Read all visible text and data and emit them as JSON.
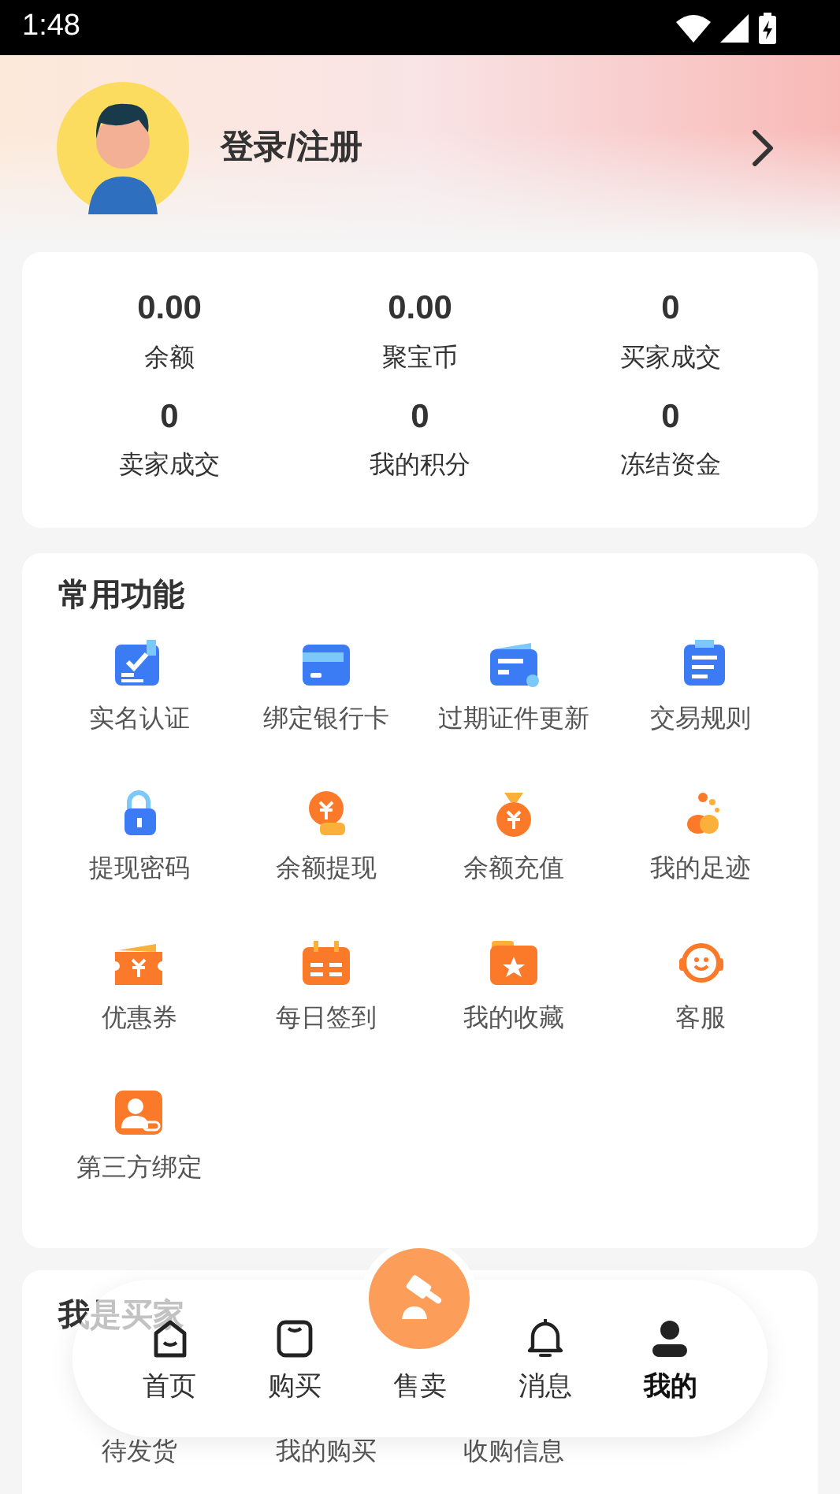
{
  "status_bar": {
    "time": "1:48"
  },
  "profile": {
    "login_label": "登录/注册"
  },
  "stats": [
    {
      "value": "0.00",
      "label": "余额"
    },
    {
      "value": "0.00",
      "label": "聚宝币"
    },
    {
      "value": "0",
      "label": "买家成交"
    },
    {
      "value": "0",
      "label": "卖家成交"
    },
    {
      "value": "0",
      "label": "我的积分"
    },
    {
      "value": "0",
      "label": "冻结资金"
    }
  ],
  "common_functions": {
    "title": "常用功能",
    "items": [
      {
        "label": "实名认证"
      },
      {
        "label": "绑定银行卡"
      },
      {
        "label": "过期证件更新"
      },
      {
        "label": "交易规则"
      },
      {
        "label": "提现密码"
      },
      {
        "label": "余额提现"
      },
      {
        "label": "余额充值"
      },
      {
        "label": "我的足迹"
      },
      {
        "label": "优惠券"
      },
      {
        "label": "每日签到"
      },
      {
        "label": "我的收藏"
      },
      {
        "label": "客服"
      },
      {
        "label": "第三方绑定"
      }
    ]
  },
  "buyer_section": {
    "title": "我是买家",
    "items": [
      {
        "label": "待发货"
      },
      {
        "label": "我的购买"
      },
      {
        "label": "收购信息"
      }
    ]
  },
  "tab_bar": [
    {
      "kind": "tab",
      "label": "首页",
      "selected": false
    },
    {
      "kind": "tab",
      "label": "购买",
      "selected": false
    },
    {
      "kind": "center",
      "label": "售卖",
      "selected": false
    },
    {
      "kind": "tab",
      "label": "消息",
      "selected": false
    },
    {
      "kind": "tab",
      "label": "我的",
      "selected": true
    }
  ]
}
